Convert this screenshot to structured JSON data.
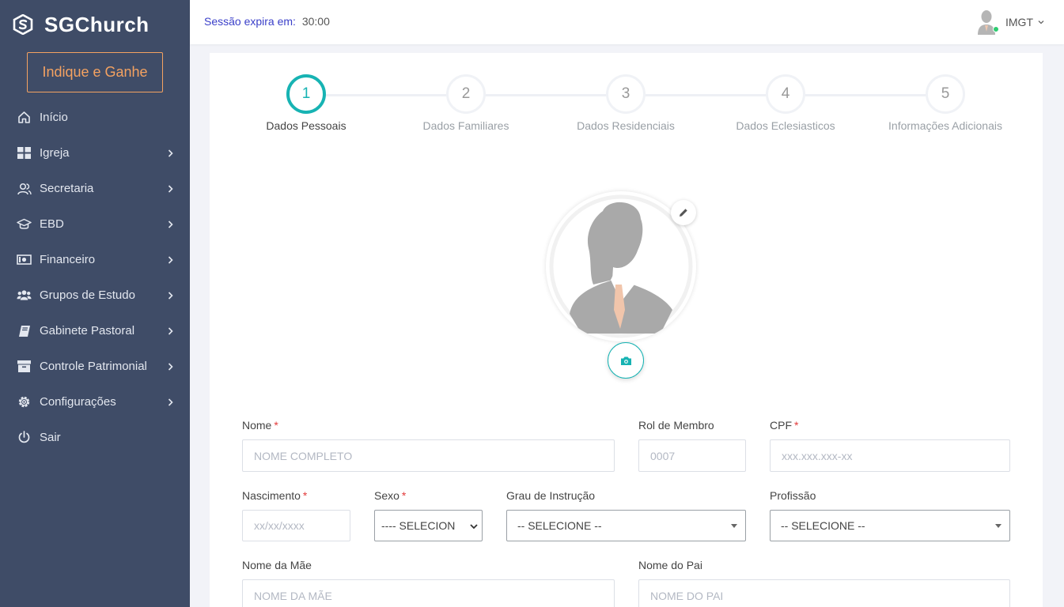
{
  "app": {
    "name": "SGChurch"
  },
  "sidebar": {
    "promo_label": "Indique e Ganhe",
    "items": [
      {
        "label": "Início",
        "icon": "home-icon",
        "has_submenu": false
      },
      {
        "label": "Igreja",
        "icon": "grid-icon",
        "has_submenu": true
      },
      {
        "label": "Secretaria",
        "icon": "users-icon",
        "has_submenu": true
      },
      {
        "label": "EBD",
        "icon": "graduation-cap-icon",
        "has_submenu": true
      },
      {
        "label": "Financeiro",
        "icon": "money-icon",
        "has_submenu": true
      },
      {
        "label": "Grupos de Estudo",
        "icon": "group-icon",
        "has_submenu": true
      },
      {
        "label": "Gabinete Pastoral",
        "icon": "book-icon",
        "has_submenu": true
      },
      {
        "label": "Controle Patrimonial",
        "icon": "archive-icon",
        "has_submenu": true
      },
      {
        "label": "Configurações",
        "icon": "gear-icon",
        "has_submenu": true
      },
      {
        "label": "Sair",
        "icon": "power-icon",
        "has_submenu": false
      }
    ]
  },
  "header": {
    "session_label": "Sessão expira em:",
    "session_value": "30:00",
    "user_name": "IMGT"
  },
  "stepper": {
    "active": 1,
    "steps": [
      {
        "number": "1",
        "label": "Dados Pessoais"
      },
      {
        "number": "2",
        "label": "Dados Familiares"
      },
      {
        "number": "3",
        "label": "Dados Residenciais"
      },
      {
        "number": "4",
        "label": "Dados Eclesiasticos"
      },
      {
        "number": "5",
        "label": "Informações Adicionais"
      }
    ]
  },
  "form": {
    "nome": {
      "label": "Nome",
      "required": "*",
      "placeholder": "NOME COMPLETO"
    },
    "rol": {
      "label": "Rol de Membro",
      "placeholder": "0007"
    },
    "cpf": {
      "label": "CPF",
      "required": "*",
      "placeholder": "xxx.xxx.xxx-xx"
    },
    "nascimento": {
      "label": "Nascimento",
      "required": "*",
      "placeholder": "xx/xx/xxxx"
    },
    "sexo": {
      "label": "Sexo",
      "required": "*",
      "value": "---- SELECION"
    },
    "grau": {
      "label": "Grau de Instrução",
      "value": "-- SELECIONE --"
    },
    "profissao": {
      "label": "Profissão",
      "value": "-- SELECIONE --"
    },
    "mae": {
      "label": "Nome da Mãe",
      "placeholder": "NOME DA MÃE"
    },
    "pai": {
      "label": "Nome do Pai",
      "placeholder": "NOME DO PAI"
    }
  },
  "colors": {
    "sidebar": "#3f4c67",
    "accent": "#17b3b3",
    "promo": "#f4a261",
    "required": "#e23b3b",
    "session": "#3a3fc9"
  }
}
